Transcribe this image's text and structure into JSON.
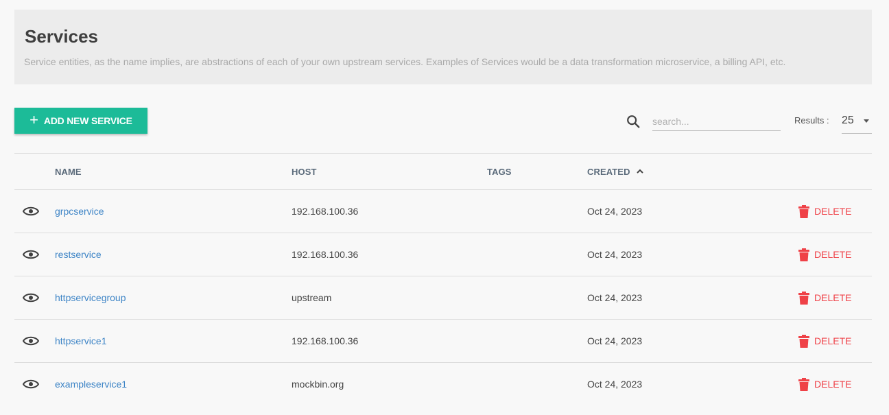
{
  "header": {
    "title": "Services",
    "description": "Service entities, as the name implies, are abstractions of each of your own upstream services. Examples of Services would be a data transformation microservice, a billing API, etc."
  },
  "toolbar": {
    "add_label": "ADD NEW SERVICE",
    "search_placeholder": "search...",
    "results_label": "Results :",
    "results_value": "25"
  },
  "table": {
    "columns": {
      "name": "NAME",
      "host": "HOST",
      "tags": "TAGS",
      "created": "CREATED"
    },
    "sort": {
      "column": "created",
      "direction": "ascending"
    },
    "delete_label": "DELETE",
    "rows": [
      {
        "name": "grpcservice",
        "host": "192.168.100.36",
        "tags": "",
        "created": "Oct 24, 2023"
      },
      {
        "name": "restservice",
        "host": "192.168.100.36",
        "tags": "",
        "created": "Oct 24, 2023"
      },
      {
        "name": "httpservicegroup",
        "host": "upstream",
        "tags": "",
        "created": "Oct 24, 2023"
      },
      {
        "name": "httpservice1",
        "host": "192.168.100.36",
        "tags": "",
        "created": "Oct 24, 2023"
      },
      {
        "name": "exampleservice1",
        "host": "mockbin.org",
        "tags": "",
        "created": "Oct 24, 2023"
      }
    ]
  },
  "colors": {
    "accent": "#1cbb98",
    "link": "#3d84c6",
    "danger": "#ef4147"
  },
  "icons": {
    "view": "eye-icon",
    "delete": "trash-icon",
    "search": "search-icon",
    "add": "plus-icon",
    "sort": "chevron-up-icon",
    "select": "caret-down-icon"
  }
}
